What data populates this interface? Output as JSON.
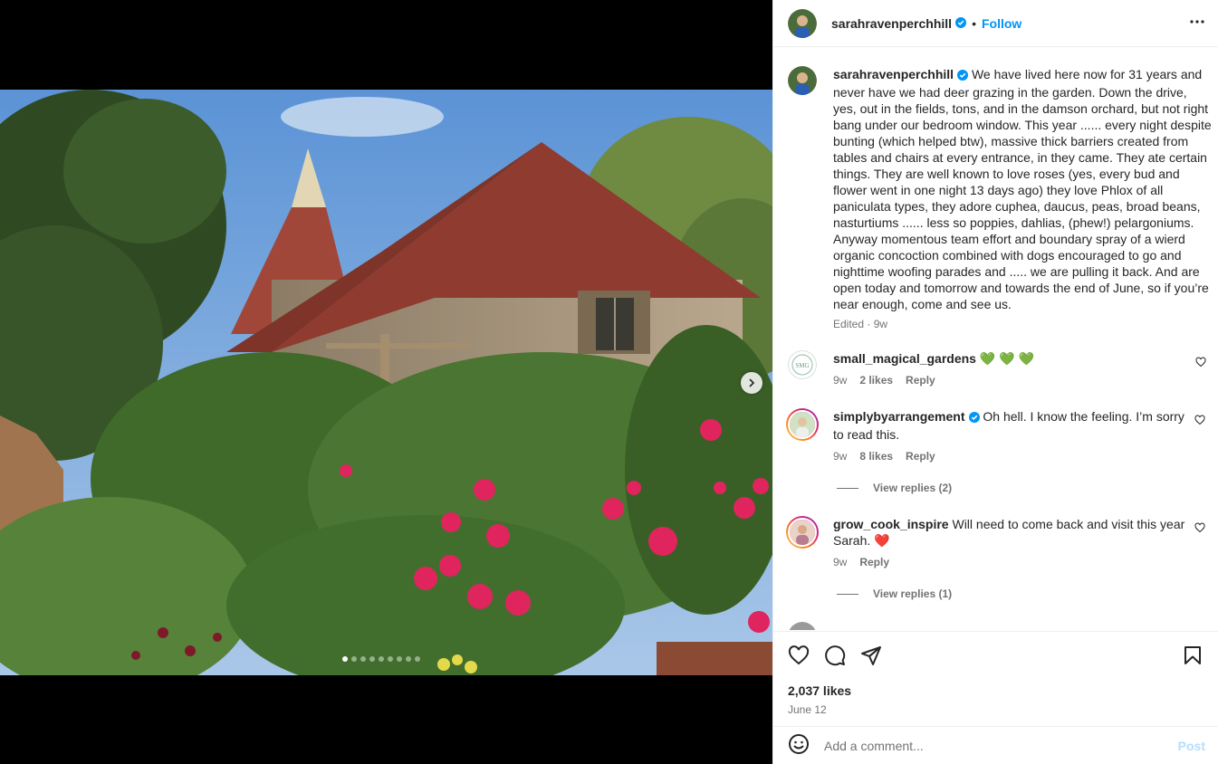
{
  "post": {
    "username": "sarahravenperchhill",
    "separator": "•",
    "follow_label": "Follow",
    "caption": "We have lived here now for 31 years and never have we had deer grazing in the garden. Down the drive, yes, out in the fields, tons, and in the damson orchard, but not right bang under our bedroom window. This year ...... every night despite bunting (which helped btw), massive thick barriers created from tables and chairs at every entrance, in they came. They ate certain things. They are well known to love roses (yes, every bud and flower went in one night 13 days ago) they love Phlox of all paniculata types, they adore cuphea, daucus, peas, broad beans, nasturtiums ...... less so poppies, dahlias, (phew!) pelargoniums. Anyway momentous team effort and boundary spray of a wierd organic concoction combined with dogs encouraged to go and nighttime woofing parades and ..... we are pulling it back. And are open today and tomorrow and towards the end of June, so if you’re near enough, come and see us.",
    "edited": "Edited · 9w",
    "likes": "2,037 likes",
    "date": "June 12",
    "carousel": {
      "total": 9,
      "active": 1
    }
  },
  "comments": [
    {
      "username": "small_magical_gardens",
      "verified": false,
      "text": "💚 💚 💚",
      "time": "9w",
      "likes": "2 likes",
      "reply": "Reply",
      "view_replies": ""
    },
    {
      "username": "simplybyarrangement",
      "verified": true,
      "text": "Oh hell. I know the feeling. I’m sorry to read this.",
      "time": "9w",
      "likes": "8 likes",
      "reply": "Reply",
      "view_replies": "View replies (2)"
    },
    {
      "username": "grow_cook_inspire",
      "verified": false,
      "text": "Will need to come back and visit this year Sarah. ❤️",
      "time": "9w",
      "likes": "",
      "reply": "Reply",
      "view_replies": "View replies (1)"
    }
  ],
  "add_comment": {
    "placeholder": "Add a comment...",
    "post_label": "Post"
  },
  "icons": [
    "heart-icon",
    "comment-icon",
    "share-icon",
    "bookmark-icon",
    "emoji-icon",
    "more-icon",
    "verified-icon",
    "chevron-right-icon"
  ],
  "colors": {
    "link": "#0095f6",
    "post_disabled": "#b2dffc",
    "meta": "#737373",
    "verified": "#0095f6",
    "heart_red": "#ff3040"
  }
}
